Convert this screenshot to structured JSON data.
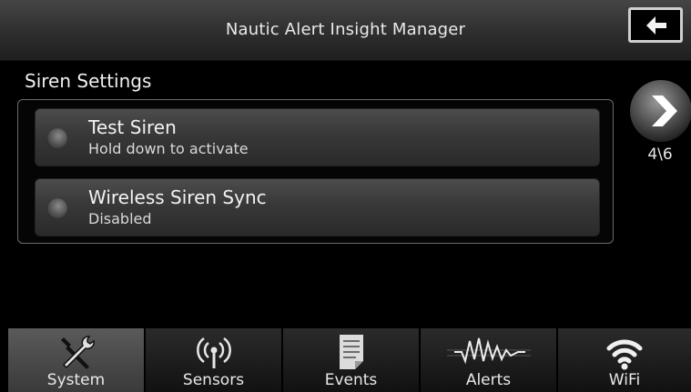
{
  "header": {
    "title": "Nautic Alert Insight Manager",
    "back_icon": "arrow-left-icon"
  },
  "section": {
    "title": "Siren Settings"
  },
  "settings": [
    {
      "title": "Test Siren",
      "subtitle": "Hold down to activate",
      "icon": "radio-indicator-icon"
    },
    {
      "title": "Wireless Siren Sync",
      "subtitle": "Disabled",
      "icon": "radio-indicator-icon"
    }
  ],
  "pager": {
    "indicator": "4\\6",
    "next_icon": "chevron-right-icon"
  },
  "tabs": [
    {
      "label": "System",
      "icon": "tools-icon",
      "active": true
    },
    {
      "label": "Sensors",
      "icon": "antenna-icon",
      "active": false
    },
    {
      "label": "Events",
      "icon": "document-icon",
      "active": false
    },
    {
      "label": "Alerts",
      "icon": "waveform-icon",
      "active": false
    },
    {
      "label": "WiFi",
      "icon": "wifi-icon",
      "active": false
    }
  ],
  "colors": {
    "background": "#000000",
    "header": "#333333",
    "row": "#404040",
    "active_tab": "#4a4a4a"
  }
}
